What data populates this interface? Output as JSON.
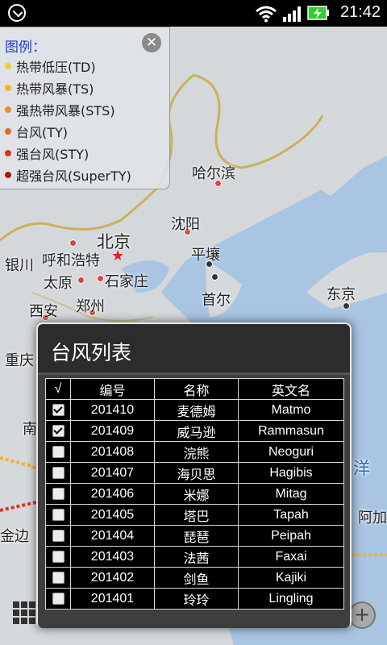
{
  "status_bar": {
    "time": "21:42"
  },
  "legend": {
    "title": "图例：",
    "items": [
      {
        "label": "热带低压(TD)",
        "color": "#e8d23a"
      },
      {
        "label": "热带风暴(TS)",
        "color": "#f0b42a"
      },
      {
        "label": "强热带风暴(STS)",
        "color": "#eb8c28"
      },
      {
        "label": "台风(TY)",
        "color": "#e06a20"
      },
      {
        "label": "强台风(STY)",
        "color": "#d8351e"
      },
      {
        "label": "超强台风(SuperTY)",
        "color": "#b3121a"
      }
    ]
  },
  "map": {
    "cities": [
      {
        "name": "哈尔滨"
      },
      {
        "name": "沈阳"
      },
      {
        "name": "北京"
      },
      {
        "name": "平壤"
      },
      {
        "name": "银川"
      },
      {
        "name": "呼和浩特"
      },
      {
        "name": "太原"
      },
      {
        "name": "石家庄"
      },
      {
        "name": "首尔"
      },
      {
        "name": "东京"
      },
      {
        "name": "西安"
      },
      {
        "name": "郑州"
      },
      {
        "name": "重庆"
      },
      {
        "name": "南"
      },
      {
        "name": "洋"
      },
      {
        "name": "阿加"
      },
      {
        "name": "金边"
      }
    ]
  },
  "dialog": {
    "title": "台风列表",
    "columns": [
      "√",
      "编号",
      "名称",
      "英文名"
    ],
    "rows": [
      {
        "checked": true,
        "code": "201410",
        "name": "麦德姆",
        "en": "Matmo"
      },
      {
        "checked": true,
        "code": "201409",
        "name": "威马逊",
        "en": "Rammasun"
      },
      {
        "checked": false,
        "code": "201408",
        "name": "浣熊",
        "en": "Neoguri"
      },
      {
        "checked": false,
        "code": "201407",
        "name": "海贝思",
        "en": "Hagibis"
      },
      {
        "checked": false,
        "code": "201406",
        "name": "米娜",
        "en": "Mitag"
      },
      {
        "checked": false,
        "code": "201405",
        "name": "塔巴",
        "en": "Tapah"
      },
      {
        "checked": false,
        "code": "201404",
        "name": "琵琶",
        "en": "Peipah"
      },
      {
        "checked": false,
        "code": "201403",
        "name": "法茜",
        "en": "Faxai"
      },
      {
        "checked": false,
        "code": "201402",
        "name": "剑鱼",
        "en": "Kajiki"
      },
      {
        "checked": false,
        "code": "201401",
        "name": "玲玲",
        "en": "Lingling"
      }
    ]
  }
}
